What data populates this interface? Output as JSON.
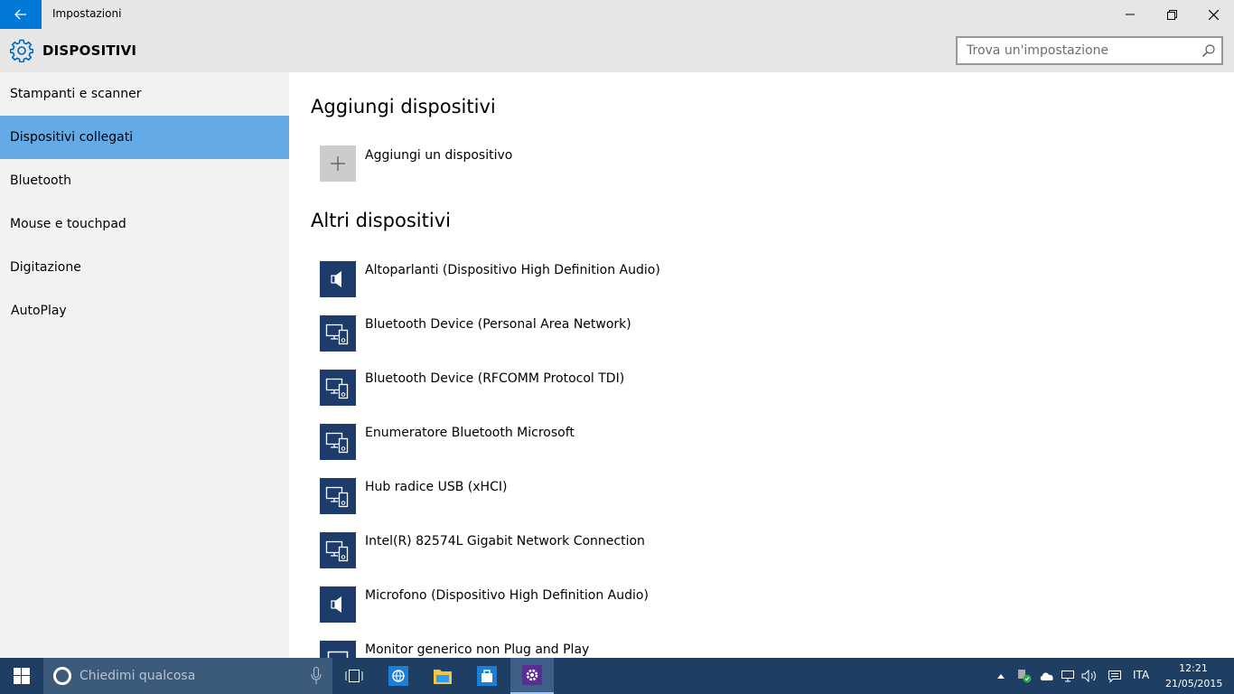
{
  "window": {
    "title": "Impostazioni",
    "controls": [
      "minimize-icon",
      "restore-icon",
      "close-icon"
    ]
  },
  "header": {
    "title": "DISPOSITIVI",
    "icon": "gear-icon",
    "search_placeholder": "Trova un'impostazione"
  },
  "sidebar": {
    "items": [
      {
        "label": "Stampanti e scanner",
        "active": false
      },
      {
        "label": "Dispositivi collegati",
        "active": true
      },
      {
        "label": "Bluetooth",
        "active": false
      },
      {
        "label": "Mouse e touchpad",
        "active": false
      },
      {
        "label": "Digitazione",
        "active": false
      },
      {
        "label": "AutoPlay",
        "active": false
      }
    ]
  },
  "main": {
    "add_section_title": "Aggiungi dispositivi",
    "add_device_label": "Aggiungi un dispositivo",
    "other_section_title": "Altri dispositivi",
    "devices": [
      {
        "name": "Altoparlanti (Dispositivo High Definition Audio)",
        "icon": "speaker-icon"
      },
      {
        "name": "Bluetooth Device (Personal Area Network)",
        "icon": "devices-icon"
      },
      {
        "name": "Bluetooth Device (RFCOMM Protocol TDI)",
        "icon": "devices-icon"
      },
      {
        "name": "Enumeratore Bluetooth Microsoft",
        "icon": "devices-icon"
      },
      {
        "name": "Hub radice USB (xHCI)",
        "icon": "devices-icon"
      },
      {
        "name": "Intel(R) 82574L Gigabit Network Connection",
        "icon": "devices-icon"
      },
      {
        "name": "Microfono (Dispositivo High Definition Audio)",
        "icon": "speaker-icon"
      },
      {
        "name": "Monitor generico non Plug and Play",
        "icon": "monitor-icon"
      }
    ]
  },
  "taskbar": {
    "search_placeholder": "Chiedimi qualcosa",
    "language": "ITA",
    "time": "12:21",
    "date": "21/05/2015",
    "colors": {
      "taskbar": "#1e3f63",
      "accent": "#0078d7",
      "selected_nav": "#64aae6",
      "device_tile": "#1d3b6b"
    }
  }
}
